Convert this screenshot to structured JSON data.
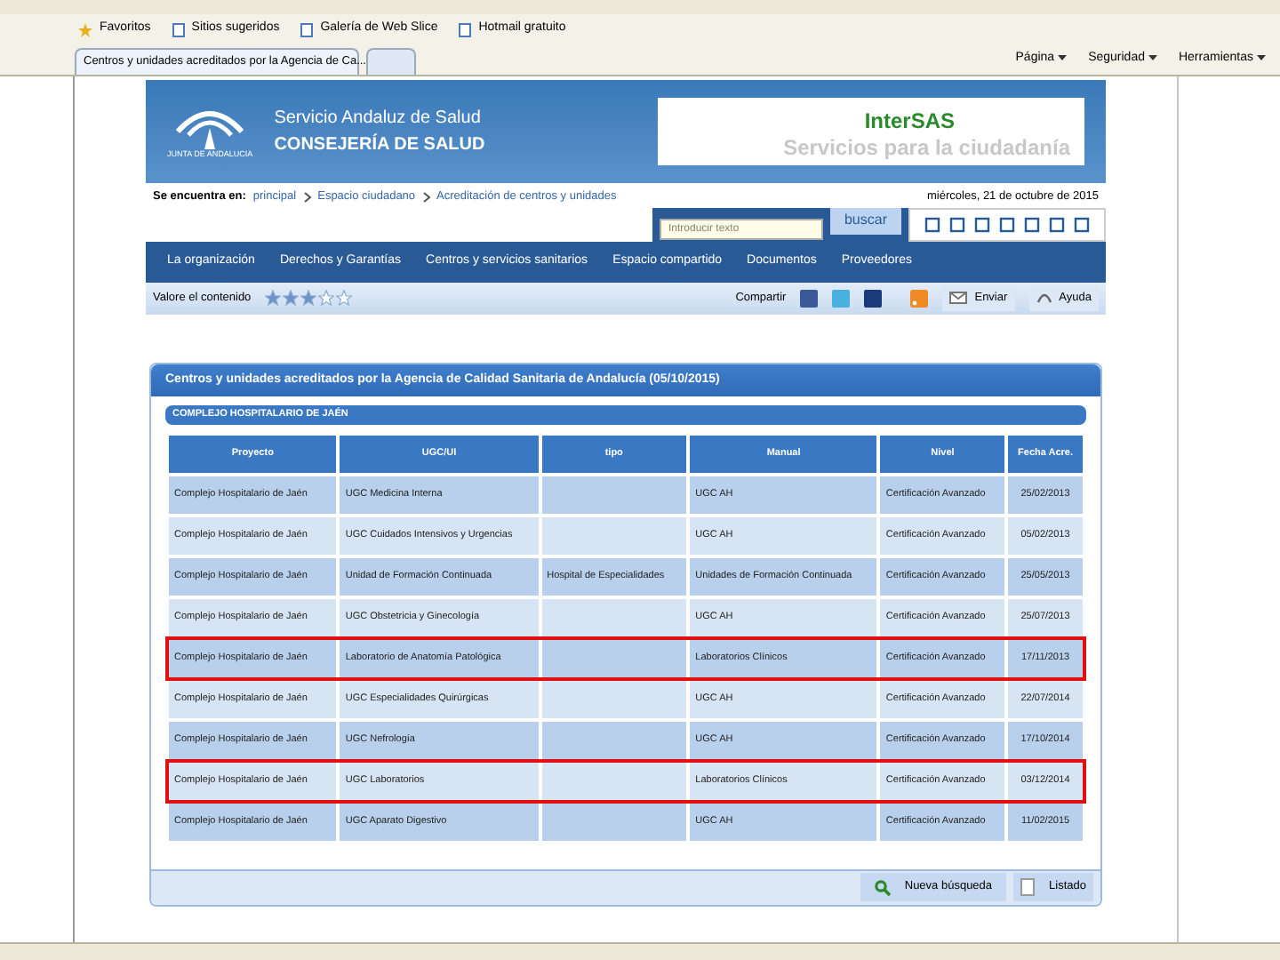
{
  "browser": {
    "favorites": "Favoritos",
    "links": [
      "Sitios sugeridos",
      "Galería de Web Slice",
      "Hotmail gratuito"
    ],
    "tab": "Centros y unidades acreditados por la Agencia de Ca...",
    "menus": [
      "Página",
      "Seguridad",
      "Herramientas"
    ]
  },
  "header": {
    "line1": "Servicio Andaluz de Salud",
    "line2": "CONSEJERÍA DE SALUD",
    "logo_text": "JUNTA DE ANDALUCIA",
    "banner_title": "InterSAS",
    "banner_subtitle": "Servicios para la ciudadanía"
  },
  "breadcrumb": {
    "label": "Se encuentra en:",
    "items": [
      "principal",
      "Espacio ciudadano",
      "Acreditación de centros y unidades"
    ],
    "date": "miércoles, 21 de octubre de 2015"
  },
  "search": {
    "placeholder": "Introducir texto",
    "button": "buscar"
  },
  "nav": [
    "La organización",
    "Derechos y Garantías",
    "Centros y servicios sanitarios",
    "Espacio compartido",
    "Documentos",
    "Proveedores"
  ],
  "rating": {
    "label": "Valore el contenido",
    "stars": 3
  },
  "share": {
    "label": "Compartir",
    "send": "Enviar",
    "help": "Ayuda"
  },
  "panel": {
    "title": "Centros y unidades acreditados por la Agencia de Calidad Sanitaria de Andalucía (05/10/2015)",
    "section": "COMPLEJO HOSPITALARIO DE JAÉN",
    "table": {
      "columns": [
        "Proyecto",
        "UGC/UI",
        "tipo",
        "Manual",
        "Nivel",
        "Fecha Acre."
      ],
      "rows": [
        {
          "cells": [
            "Complejo Hospitalario de Jaén",
            "UGC Medicina Interna",
            "",
            "UGC AH",
            "Certificación Avanzado",
            "25/02/2013"
          ],
          "highlighted": false
        },
        {
          "cells": [
            "Complejo Hospitalario de Jaén",
            "UGC Cuidados Intensivos y Urgencias",
            "",
            "UGC AH",
            "Certificación Avanzado",
            "05/02/2013"
          ],
          "highlighted": false
        },
        {
          "cells": [
            "Complejo Hospitalario de Jaén",
            "Unidad de Formación Continuada",
            "Hospital de Especialidades",
            "Unidades de Formación Continuada",
            "Certificación Avanzado",
            "25/05/2013"
          ],
          "highlighted": false
        },
        {
          "cells": [
            "Complejo Hospitalario de Jaén",
            "UGC Obstetricia y Ginecología",
            "",
            "UGC AH",
            "Certificación Avanzado",
            "25/07/2013"
          ],
          "highlighted": false
        },
        {
          "cells": [
            "Complejo Hospitalario de Jaén",
            "Laboratorio de Anatomía Patológica",
            "",
            "Laboratorios Clínicos",
            "Certificación Avanzado",
            "17/11/2013"
          ],
          "highlighted": true
        },
        {
          "cells": [
            "Complejo Hospitalario de Jaén",
            "UGC Especialidades Quirúrgicas",
            "",
            "UGC AH",
            "Certificación Avanzado",
            "22/07/2014"
          ],
          "highlighted": false
        },
        {
          "cells": [
            "Complejo Hospitalario de Jaén",
            "UGC Nefrología",
            "",
            "UGC AH",
            "Certificación Avanzado",
            "17/10/2014"
          ],
          "highlighted": false
        },
        {
          "cells": [
            "Complejo Hospitalario de Jaén",
            "UGC Laboratorios",
            "",
            "Laboratorios Clínicos",
            "Certificación Avanzado",
            "03/12/2014"
          ],
          "highlighted": true
        },
        {
          "cells": [
            "Complejo Hospitalario de Jaén",
            "UGC Aparato Digestivo",
            "",
            "UGC AH",
            "Certificación Avanzado",
            "11/02/2015"
          ],
          "highlighted": false
        }
      ]
    },
    "new_search": "Nueva búsqueda",
    "listing": "Listado"
  }
}
